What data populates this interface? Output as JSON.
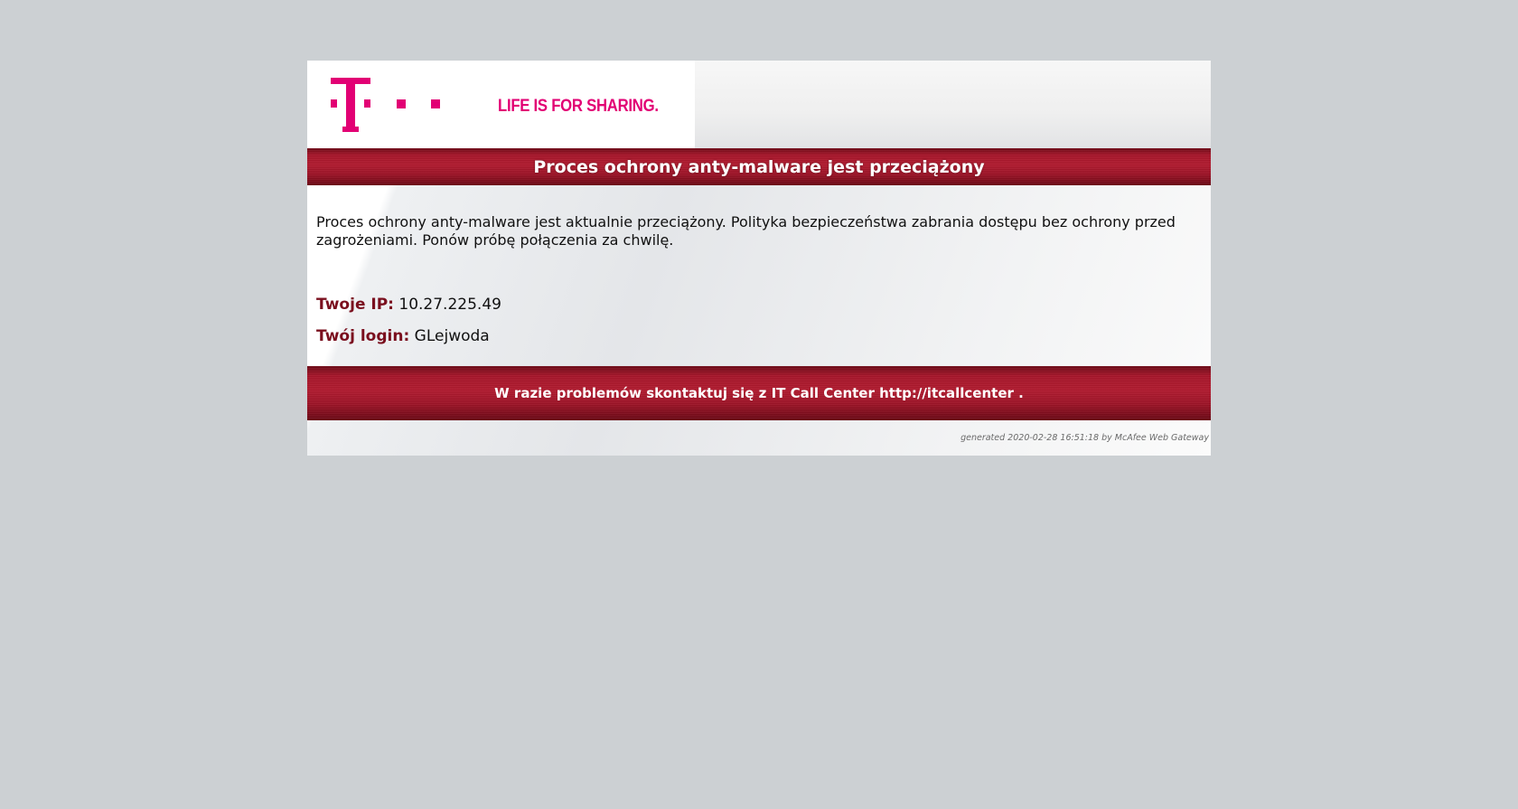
{
  "header": {
    "logo_icon": "telekom-t-logo-icon",
    "slogan": "LIFE IS FOR SHARING."
  },
  "title": "Proces ochrony anty-malware jest przeciążony",
  "message": "Proces ochrony anty-malware jest aktualnie przeciążony. Polityka bezpieczeństwa zabrania dostępu bez ochrony przed zagrożeniami. Ponów próbę połączenia za chwilę.",
  "info": {
    "ip_label": "Twoje IP:",
    "ip_value": "10.27.225.49",
    "login_label": "Twój login:",
    "login_value": "GLejwoda"
  },
  "footer": {
    "contact": "W razie problemów skontaktuj się z IT Call Center http://itcallcenter ."
  },
  "generated": "generated 2020-02-28 16:51:18 by McAfee Web Gateway",
  "colors": {
    "brand_magenta": "#e20074",
    "band_red": "#b21a2f",
    "label_dark_red": "#7a0f1e",
    "page_background": "#ccd0d3"
  }
}
